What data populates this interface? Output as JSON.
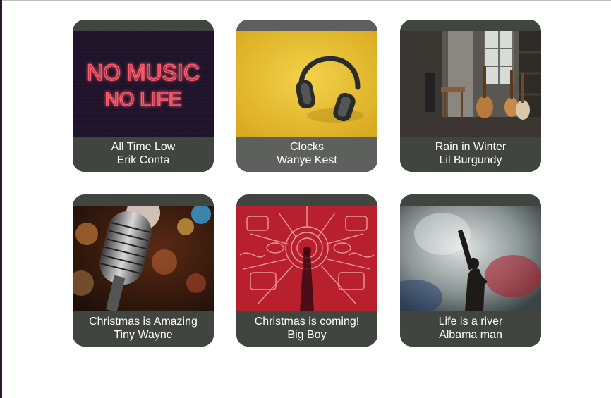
{
  "songs": [
    {
      "title": "All Time Low",
      "artist": "Erik Conta",
      "art": "neon-no-music-no-life",
      "art_text_line1": "NO MUSIC",
      "art_text_line2": "NO LIFE"
    },
    {
      "title": "Clocks",
      "artist": "Wanye Kest",
      "art": "headphones-on-yellow"
    },
    {
      "title": "Rain in Winter",
      "artist": "Lil Burgundy",
      "art": "guitars-in-room"
    },
    {
      "title": "Christmas is Amazing",
      "artist": "Tiny Wayne",
      "art": "vintage-microphone"
    },
    {
      "title": "Christmas is coming!",
      "artist": "Big Boy",
      "art": "red-instruments-illustration"
    },
    {
      "title": "Life is a river",
      "artist": "Albama man",
      "art": "concert-smoke-performer"
    }
  ],
  "colors": {
    "card_background": "#40453f",
    "card_background_active": "#5e605e",
    "caption_text": "#ffffff",
    "page_background": "#ffffff"
  }
}
